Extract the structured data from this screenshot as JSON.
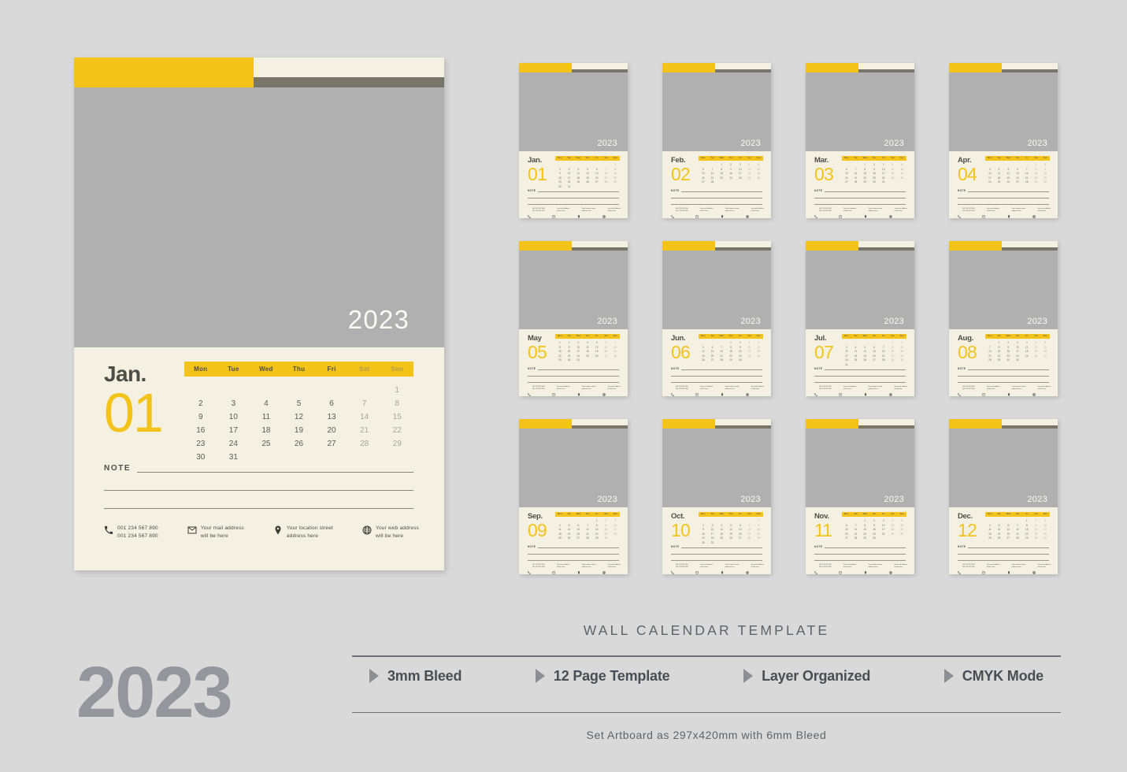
{
  "page": {
    "background_color": "#d9d9d9",
    "accent_yellow": "#f3c31a",
    "cream": "#f4f1e3",
    "photo_gray": "#b0b0b0",
    "dark_strip": "#78756a"
  },
  "main_calendar": {
    "year": "2023",
    "month_name": "Jan.",
    "month_number": "01",
    "weekdays": [
      "Mon",
      "Tue",
      "Wed",
      "Thu",
      "Fri",
      "Sat",
      "Sun"
    ],
    "days": [
      "",
      "",
      "",
      "",
      "",
      "",
      "1",
      "2",
      "3",
      "4",
      "5",
      "6",
      "7",
      "8",
      "9",
      "10",
      "11",
      "12",
      "13",
      "14",
      "15",
      "16",
      "17",
      "18",
      "19",
      "20",
      "21",
      "22",
      "23",
      "24",
      "25",
      "26",
      "27",
      "28",
      "29",
      "30",
      "31",
      "",
      "",
      "",
      "",
      ""
    ],
    "note_label": "NOTE",
    "contacts": [
      {
        "icon": "phone-icon",
        "line1": "001 234 567 890",
        "line2": "001 234 567 890"
      },
      {
        "icon": "mail-icon",
        "line1": "Your mail address",
        "line2": "will be here"
      },
      {
        "icon": "location-pin-icon",
        "line1": "Your location street",
        "line2": "address here"
      },
      {
        "icon": "globe-icon",
        "line1": "Your web address",
        "line2": "will be here"
      }
    ]
  },
  "thumbnails": [
    {
      "month_name": "Jan.",
      "month_number": "01",
      "year": "2023",
      "days": [
        "",
        "",
        "",
        "",
        "",
        "",
        "1",
        "2",
        "3",
        "4",
        "5",
        "6",
        "7",
        "8",
        "9",
        "10",
        "11",
        "12",
        "13",
        "14",
        "15",
        "16",
        "17",
        "18",
        "19",
        "20",
        "21",
        "22",
        "23",
        "24",
        "25",
        "26",
        "27",
        "28",
        "29",
        "30",
        "31",
        "",
        "",
        "",
        "",
        ""
      ]
    },
    {
      "month_name": "Feb.",
      "month_number": "02",
      "year": "2023",
      "days": [
        "",
        "",
        "1",
        "2",
        "3",
        "4",
        "5",
        "6",
        "7",
        "8",
        "9",
        "10",
        "11",
        "12",
        "13",
        "14",
        "15",
        "16",
        "17",
        "18",
        "19",
        "20",
        "21",
        "22",
        "23",
        "24",
        "25",
        "26",
        "27",
        "28",
        "",
        "",
        "",
        "",
        "",
        "",
        "",
        "",
        "",
        "",
        "",
        ""
      ]
    },
    {
      "month_name": "Mar.",
      "month_number": "03",
      "year": "2023",
      "days": [
        "",
        "",
        "1",
        "2",
        "3",
        "4",
        "5",
        "6",
        "7",
        "8",
        "9",
        "10",
        "11",
        "12",
        "13",
        "14",
        "15",
        "16",
        "17",
        "18",
        "19",
        "20",
        "21",
        "22",
        "23",
        "24",
        "25",
        "26",
        "27",
        "28",
        "29",
        "30",
        "31",
        "",
        "",
        "",
        "",
        "",
        "",
        "",
        "",
        ""
      ]
    },
    {
      "month_name": "Apr.",
      "month_number": "04",
      "year": "2023",
      "days": [
        "",
        "",
        "",
        "",
        "",
        "1",
        "2",
        "3",
        "4",
        "5",
        "6",
        "7",
        "8",
        "9",
        "10",
        "11",
        "12",
        "13",
        "14",
        "15",
        "16",
        "17",
        "18",
        "19",
        "20",
        "21",
        "22",
        "23",
        "24",
        "25",
        "26",
        "27",
        "28",
        "29",
        "30",
        "",
        "",
        "",
        "",
        "",
        "",
        ""
      ]
    },
    {
      "month_name": "May",
      "month_number": "05",
      "year": "2023",
      "days": [
        "1",
        "2",
        "3",
        "4",
        "5",
        "6",
        "7",
        "8",
        "9",
        "10",
        "11",
        "12",
        "13",
        "14",
        "15",
        "16",
        "17",
        "18",
        "19",
        "20",
        "21",
        "22",
        "23",
        "24",
        "25",
        "26",
        "27",
        "28",
        "29",
        "30",
        "31",
        "",
        "",
        "",
        "",
        "",
        "",
        "",
        "",
        "",
        "",
        ""
      ]
    },
    {
      "month_name": "Jun.",
      "month_number": "06",
      "year": "2023",
      "days": [
        "",
        "",
        "",
        "1",
        "2",
        "3",
        "4",
        "5",
        "6",
        "7",
        "8",
        "9",
        "10",
        "11",
        "12",
        "13",
        "14",
        "15",
        "16",
        "17",
        "18",
        "19",
        "20",
        "21",
        "22",
        "23",
        "24",
        "25",
        "26",
        "27",
        "28",
        "29",
        "30",
        "",
        "",
        "",
        "",
        "",
        "",
        "",
        "",
        ""
      ]
    },
    {
      "month_name": "Jul.",
      "month_number": "07",
      "year": "2023",
      "days": [
        "",
        "",
        "",
        "",
        "",
        "1",
        "2",
        "3",
        "4",
        "5",
        "6",
        "7",
        "8",
        "9",
        "10",
        "11",
        "12",
        "13",
        "14",
        "15",
        "16",
        "17",
        "18",
        "19",
        "20",
        "21",
        "22",
        "23",
        "24",
        "25",
        "26",
        "27",
        "28",
        "29",
        "30",
        "31",
        "",
        "",
        "",
        "",
        "",
        ""
      ]
    },
    {
      "month_name": "Aug.",
      "month_number": "08",
      "year": "2023",
      "days": [
        "",
        "1",
        "2",
        "3",
        "4",
        "5",
        "6",
        "7",
        "8",
        "9",
        "10",
        "11",
        "12",
        "13",
        "14",
        "15",
        "16",
        "17",
        "18",
        "19",
        "20",
        "21",
        "22",
        "23",
        "24",
        "25",
        "26",
        "27",
        "28",
        "29",
        "30",
        "31",
        "",
        "",
        "",
        "",
        "",
        "",
        "",
        "",
        "",
        ""
      ]
    },
    {
      "month_name": "Sep.",
      "month_number": "09",
      "year": "2023",
      "days": [
        "",
        "",
        "",
        "",
        "1",
        "2",
        "3",
        "4",
        "5",
        "6",
        "7",
        "8",
        "9",
        "10",
        "11",
        "12",
        "13",
        "14",
        "15",
        "16",
        "17",
        "18",
        "19",
        "20",
        "21",
        "22",
        "23",
        "24",
        "25",
        "26",
        "27",
        "28",
        "29",
        "30",
        "",
        "",
        "",
        "",
        "",
        "",
        "",
        ""
      ]
    },
    {
      "month_name": "Oct.",
      "month_number": "10",
      "year": "2023",
      "days": [
        "",
        "",
        "",
        "",
        "",
        "",
        "1",
        "2",
        "3",
        "4",
        "5",
        "6",
        "7",
        "8",
        "9",
        "10",
        "11",
        "12",
        "13",
        "14",
        "15",
        "16",
        "17",
        "18",
        "19",
        "20",
        "21",
        "22",
        "23",
        "24",
        "25",
        "26",
        "27",
        "28",
        "29",
        "30",
        "31",
        "",
        "",
        "",
        "",
        ""
      ]
    },
    {
      "month_name": "Nov.",
      "month_number": "11",
      "year": "2023",
      "days": [
        "",
        "",
        "1",
        "2",
        "3",
        "4",
        "5",
        "6",
        "7",
        "8",
        "9",
        "10",
        "11",
        "12",
        "13",
        "14",
        "15",
        "16",
        "17",
        "18",
        "19",
        "20",
        "21",
        "22",
        "23",
        "24",
        "25",
        "26",
        "27",
        "28",
        "29",
        "30",
        "",
        "",
        "",
        "",
        "",
        "",
        "",
        "",
        "",
        ""
      ]
    },
    {
      "month_name": "Dec.",
      "month_number": "12",
      "year": "2023",
      "days": [
        "",
        "",
        "",
        "",
        "1",
        "2",
        "3",
        "4",
        "5",
        "6",
        "7",
        "8",
        "9",
        "10",
        "11",
        "12",
        "13",
        "14",
        "15",
        "16",
        "17",
        "18",
        "19",
        "20",
        "21",
        "22",
        "23",
        "24",
        "25",
        "26",
        "27",
        "28",
        "29",
        "30",
        "31",
        "",
        "",
        "",
        "",
        "",
        "",
        ""
      ]
    }
  ],
  "footer": {
    "big_year": "2023",
    "title": "WALL CALENDAR TEMPLATE",
    "features": [
      {
        "label": "3mm Bleed"
      },
      {
        "label": "12 Page Template"
      },
      {
        "label": "Layer Organized"
      },
      {
        "label": "CMYK Mode"
      }
    ],
    "subtitle": "Set Artboard as 297x420mm with 6mm Bleed"
  }
}
